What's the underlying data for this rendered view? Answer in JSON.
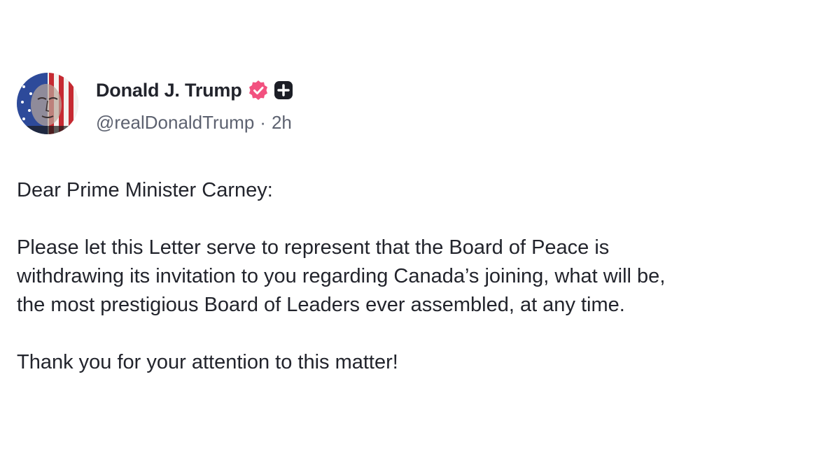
{
  "author": {
    "display_name": "Donald J. Trump",
    "handle": "@realDonaldTrump",
    "separator": "·",
    "time": "2h",
    "verified_color": "#f2517f",
    "badge_color": "#1c1e26"
  },
  "post": {
    "greeting": "Dear Prime Minister Carney:",
    "line1": "Please let this Letter serve to represent that the Board of Peace is",
    "line2": "withdrawing its invitation to you regarding Canada’s joining, what will be,",
    "line3": "the most prestigious Board of Leaders ever assembled, at any time.",
    "closing": "Thank you for your attention to this matter!"
  },
  "icons": {
    "avatar": "profile-avatar",
    "verified": "verified-check-icon",
    "plus": "plus-badge-icon"
  }
}
